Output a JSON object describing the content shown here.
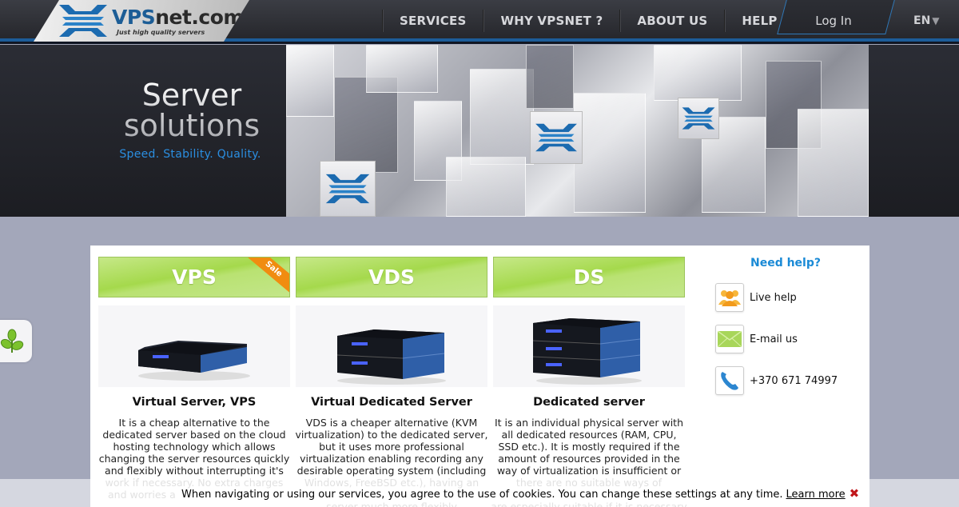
{
  "header": {
    "logo_brand_a": "VPS",
    "logo_brand_b": "net.com",
    "logo_tagline": "Just high quality servers",
    "nav": [
      {
        "label": "SERVICES"
      },
      {
        "label": "WHY VPSNET ?"
      },
      {
        "label": "ABOUT US"
      },
      {
        "label": "HELP"
      }
    ],
    "login_label": "Log In",
    "language": "EN",
    "language_caret": "▼"
  },
  "banner": {
    "title_line1": "Server",
    "title_line2": "solutions",
    "subtitle": "Speed. Stability. Quality."
  },
  "products": [
    {
      "header": "VPS",
      "badge": "Sale",
      "title": "Virtual Server, VPS",
      "lines": [
        "It is a cheap alternative to the",
        "dedicated server based on the cloud",
        "hosting technology which allows",
        "changing the server resources quickly",
        "and flexibly without interrupting it's"
      ],
      "faded_lines": [
        "work if necessary. No extra charges",
        "and worries a"
      ]
    },
    {
      "header": "VDS",
      "title": "Virtual Dedicated Server",
      "lines": [
        "VDS is a cheaper alternative (KVM",
        "virtualization) to the dedicated server,",
        "but it uses more professional",
        "virtualization enabling recording any",
        "desirable operating system (including"
      ],
      "faded_lines": [
        "Windows, FreeBSD etc.), having an",
        "",
        "server much more flexibly"
      ]
    },
    {
      "header": "DS",
      "title": "Dedicated server",
      "lines": [
        "It is an individual physical server with",
        "all dedicated resources (RAM, CPU,",
        "SSD etc.). It is mostly required if the",
        "amount of resources provided in the",
        "way of virtualization is insufficient or"
      ],
      "faded_lines": [
        "there are no suitable ways of",
        "",
        "are especially suitable if it is necessary"
      ]
    }
  ],
  "help": {
    "title": "Need help?",
    "items": [
      {
        "label": "Live help",
        "icon": "people-icon"
      },
      {
        "label": "E-mail us",
        "icon": "envelope-icon"
      },
      {
        "label": "+370 671 74997",
        "icon": "phone-icon"
      }
    ]
  },
  "cookie": {
    "text": "When navigating or using our services, you agree to the use of cookies. You can change these settings at any time.",
    "link": "Learn more",
    "close": "✖"
  },
  "colors": {
    "accent_blue": "#1a8ad6",
    "header_border": "#1c5c99",
    "product_green": "#a5d94c",
    "sale_orange": "#f08c10",
    "close_red": "#c0161b"
  }
}
